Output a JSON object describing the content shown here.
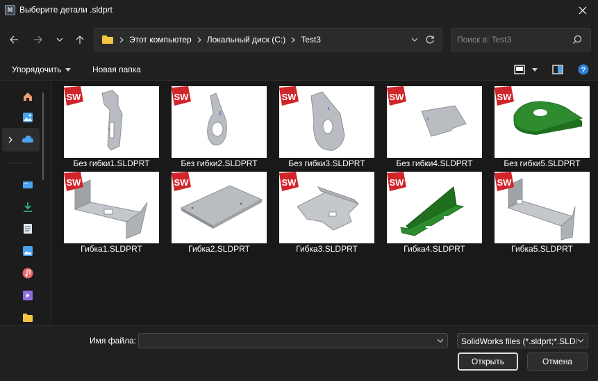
{
  "window": {
    "title": "Выберите детали .sldprt",
    "app_icon_letter": "M"
  },
  "address": {
    "crumbs": [
      "Этот компьютер",
      "Локальный диск (C:)",
      "Test3"
    ]
  },
  "search": {
    "placeholder": "Поиск в: Test3"
  },
  "toolbar": {
    "organize_label": "Упорядочить",
    "new_folder_label": "Новая папка",
    "help_label": "?"
  },
  "files": [
    {
      "name": "Без гибки1.SLDPRT"
    },
    {
      "name": "Без гибки2.SLDPRT"
    },
    {
      "name": "Без гибки3.SLDPRT"
    },
    {
      "name": "Без гибки4.SLDPRT"
    },
    {
      "name": "Без гибки5.SLDPRT"
    },
    {
      "name": "Гибка1.SLDPRT"
    },
    {
      "name": "Гибка2.SLDPRT"
    },
    {
      "name": "Гибка3.SLDPRT"
    },
    {
      "name": "Гибка4.SLDPRT"
    },
    {
      "name": "Гибка5.SLDPRT"
    }
  ],
  "badge_text": "SW",
  "footer": {
    "filename_label": "Имя файла:",
    "filename_value": "",
    "filter_value": "SolidWorks files (*.sldprt;*.SLDPRT)",
    "open_label": "Открыть",
    "cancel_label": "Отмена"
  },
  "colors": {
    "background": "#191919",
    "chrome": "#202020",
    "folder": "#f4c542",
    "cloud": "#4aa3f0",
    "download": "#2ec27e",
    "music": "#e8696b",
    "video": "#8e6fe0",
    "help": "#2f7fd8",
    "sw_badge": "#d0262b",
    "part_gray": "#b9bcc0",
    "part_green": "#2e8b2e"
  }
}
